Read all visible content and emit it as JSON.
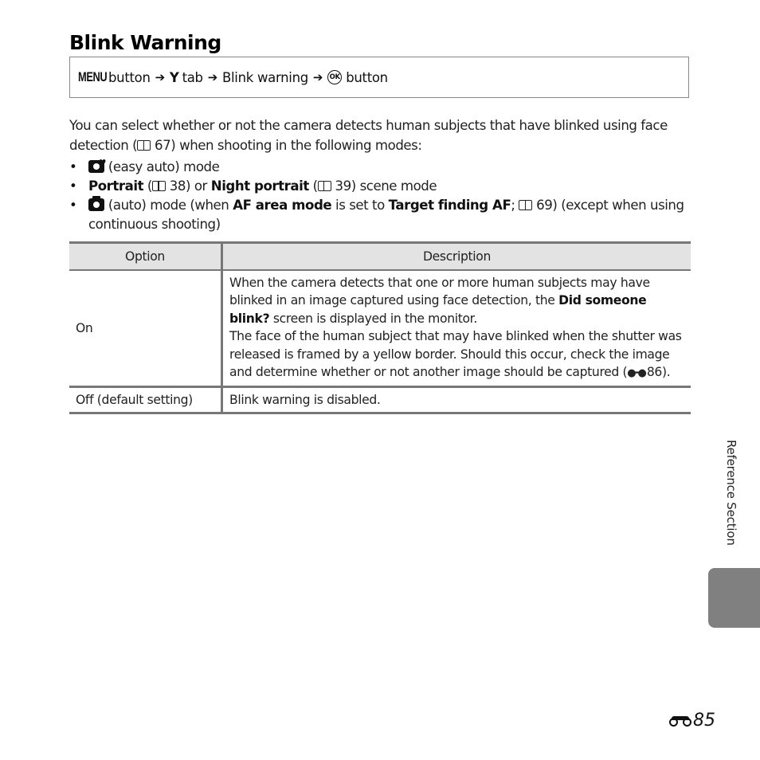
{
  "page": {
    "title": "Blink Warning",
    "nav_path": {
      "menu_label": "MENU",
      "button_word_1": "button",
      "arrow": "➔",
      "wrench_icon": "wrench-icon",
      "tab_word": "tab",
      "item": "Blink warning",
      "ok_label": "OK",
      "button_word_2": "button"
    },
    "intro": {
      "text_1": "You can select whether or not the camera detects human subjects that have blinked using face detection (",
      "ref_page": "67",
      "text_2": ") when shooting in the following modes:"
    },
    "bullets": [
      {
        "icon": "easy-auto-camera-icon",
        "text": "(easy auto) mode"
      },
      {
        "bold_1": "Portrait",
        "text_1": " (",
        "ref_1": "38",
        "text_2": ") or ",
        "bold_2": "Night portrait",
        "text_3": " (",
        "ref_2": "39",
        "text_4": ") scene mode"
      },
      {
        "icon": "auto-camera-icon",
        "text_1": "(auto) mode (when ",
        "bold_1": "AF area mode",
        "text_2": " is set to ",
        "bold_2": "Target finding AF",
        "text_3": "; ",
        "ref": "69",
        "text_4": ") (except when using continuous shooting)"
      }
    ],
    "table": {
      "headers": [
        "Option",
        "Description"
      ],
      "rows": [
        {
          "option": "On",
          "desc_1": "When the camera detects that one or more human subjects may have blinked in an image captured using face detection, the ",
          "desc_bold": "Did someone blink?",
          "desc_2": " screen is displayed in the monitor.",
          "desc_3": "The face of the human subject that may have blinked when the shutter was released is framed by a yellow border. Should this occur, check the image and determine whether or not another image should be captured (",
          "desc_ref": "86",
          "desc_4": ")."
        },
        {
          "option": "Off (default setting)",
          "desc_1": "Blink warning is disabled."
        }
      ]
    },
    "side_label": "Reference Section",
    "page_number": "85",
    "colors": {
      "table_header_bg": "#e3e3e3",
      "rule": "#777777",
      "side_tab": "#808080"
    }
  }
}
